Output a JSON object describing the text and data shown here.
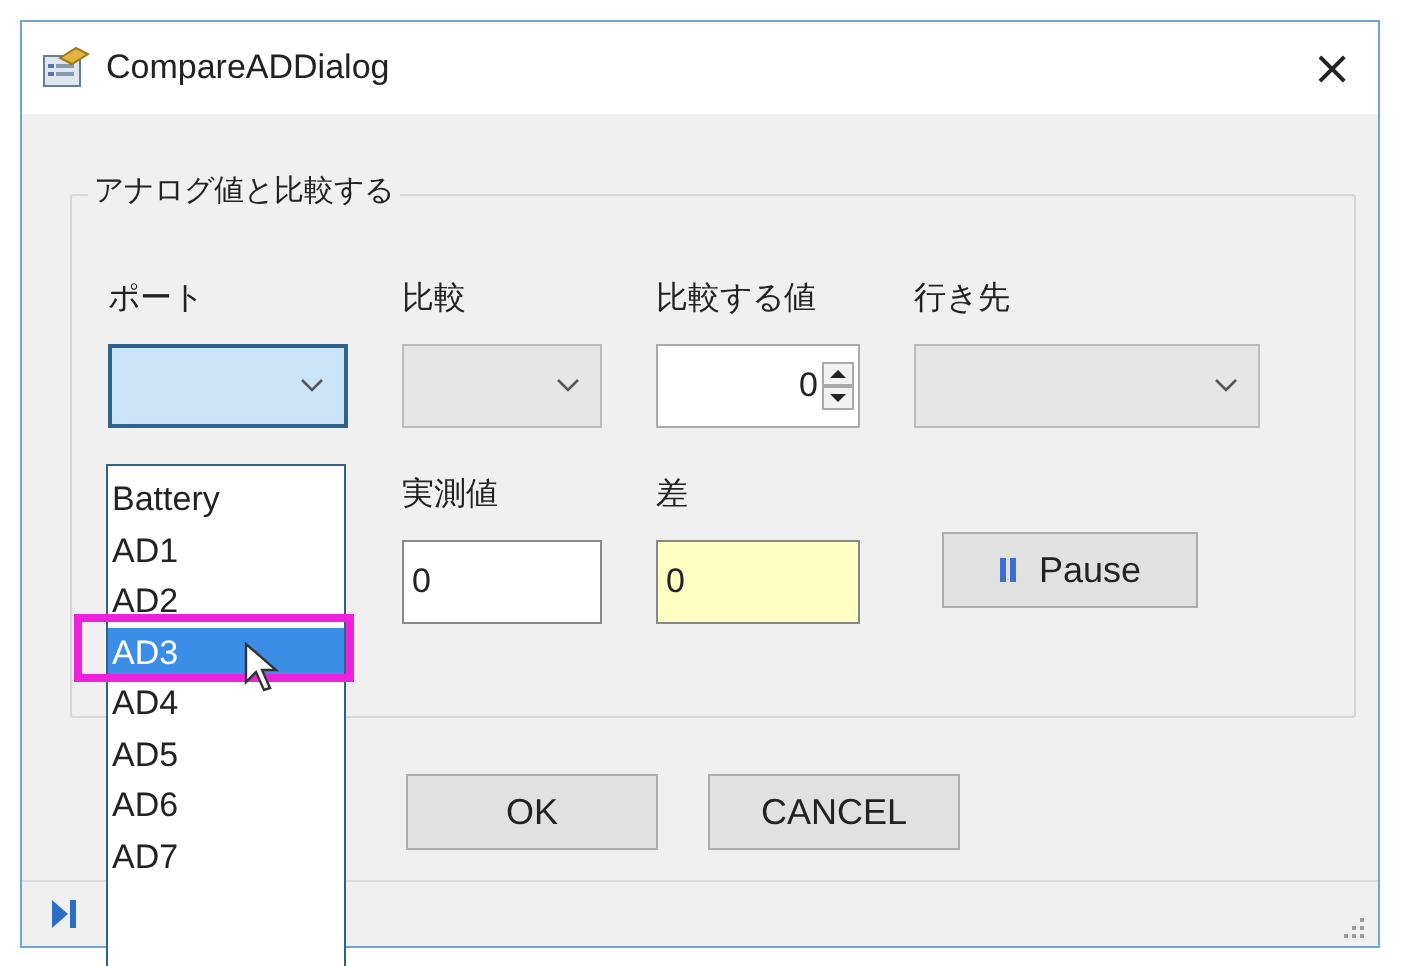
{
  "window": {
    "title": "CompareADDialog",
    "close": "×"
  },
  "group": {
    "title": "アナログ値と比較する",
    "fields": [
      {
        "label": "ポート",
        "kind": "dropdown",
        "disabled": false
      },
      {
        "label": "比較",
        "kind": "dropdown",
        "disabled": true
      },
      {
        "label": "比較する値",
        "kind": "spinner",
        "value": "0"
      },
      {
        "label": "行き先",
        "kind": "dropdown",
        "disabled": true
      }
    ],
    "readings": [
      {
        "label": "実測値",
        "value": "0",
        "highlighted": false
      },
      {
        "label": "差",
        "value": "0",
        "highlighted": true
      }
    ],
    "pause_button": {
      "label": "Pause"
    }
  },
  "buttons": [
    "OK",
    "CANCEL"
  ],
  "dropdown_list": {
    "items": [
      {
        "label": "Battery",
        "selected": false
      },
      {
        "label": "AD1",
        "selected": false
      },
      {
        "label": "AD2",
        "selected": false
      },
      {
        "label": "AD3",
        "selected": true
      },
      {
        "label": "AD4",
        "selected": false
      },
      {
        "label": "AD5",
        "selected": false
      },
      {
        "label": "AD6",
        "selected": false
      },
      {
        "label": "AD7",
        "selected": false
      }
    ]
  }
}
